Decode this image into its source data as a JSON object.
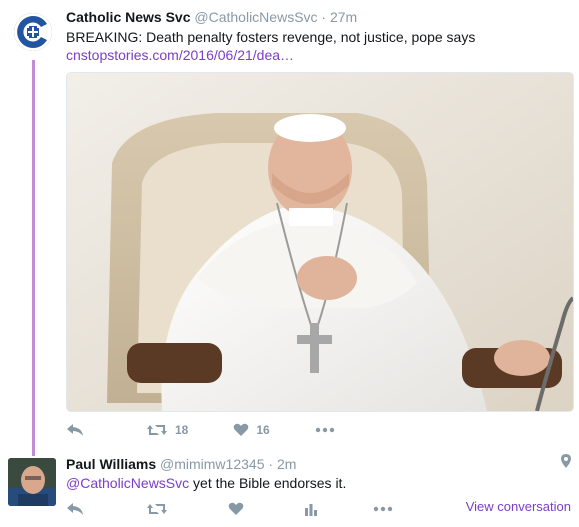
{
  "tweet1": {
    "name": "Catholic News Svc",
    "handle": "@CatholicNewsSvc",
    "separator": "·",
    "time": "27m",
    "text": "BREAKING: Death penalty fosters revenge, not justice, pope says",
    "link": "cnstopstories.com/2016/06/21/dea…",
    "media_icon": "photo-pope-seated",
    "actions": {
      "reply_icon": "reply-icon",
      "retweet_icon": "retweet-icon",
      "retweet_count": "18",
      "like_icon": "heart-icon",
      "like_count": "16",
      "more_icon": "more-icon"
    }
  },
  "tweet2": {
    "name": "Paul Williams",
    "handle": "@mimimw12345",
    "separator": "·",
    "time": "2m",
    "mention": "@CatholicNewsSvc",
    "text_rest": " yet the Bible endorses it.",
    "location_icon": "location-pin-icon",
    "view_conversation": "View conversation",
    "actions": {
      "reply_icon": "reply-icon",
      "retweet_icon": "retweet-icon",
      "like_icon": "heart-icon",
      "more_icon": "more-icon",
      "analytics_icon": "analytics-icon"
    }
  },
  "colors": {
    "thread_line": "#c48bd6",
    "link": "#7a3ec9",
    "muted": "#8899a6",
    "brand": "#2255a0"
  }
}
